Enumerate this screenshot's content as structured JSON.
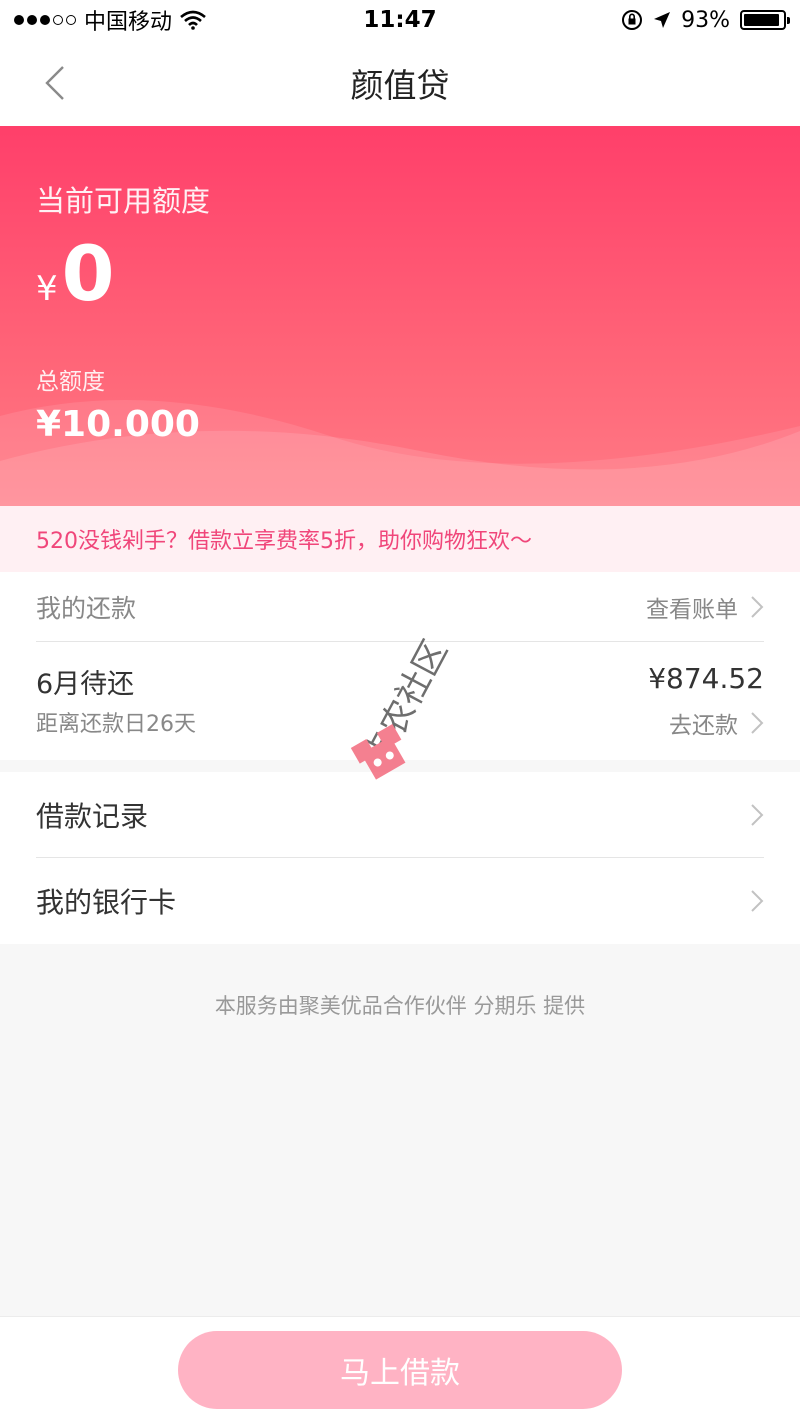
{
  "status_bar": {
    "carrier": "中国移动",
    "time": "11:47",
    "battery": "93%",
    "battery_level": 0.93,
    "signal_bars": 3
  },
  "nav": {
    "title": "颜值贷",
    "back_icon": "chevron-left-icon"
  },
  "hero": {
    "available_label": "当前可用额度",
    "currency_symbol": "¥",
    "available_value": "0",
    "total_label": "总额度",
    "total_value": "¥10.000"
  },
  "promo": {
    "text": "520没钱剁手？借款立享费率5折，助你购物狂欢～"
  },
  "repayment": {
    "section_label": "我的还款",
    "view_bill_label": "查看账单",
    "due_title": "6月待还",
    "due_subtitle": "距离还款日26天",
    "due_amount": "¥874.52",
    "repay_label": "去还款"
  },
  "menu": {
    "items": [
      {
        "label": "借款记录"
      },
      {
        "label": "我的银行卡"
      }
    ]
  },
  "footnote": "本服务由聚美优品合作伙伴 分期乐 提供",
  "bottom": {
    "borrow_label": "马上借款"
  },
  "watermark": {
    "text": "卡农社区"
  },
  "colors": {
    "brand": "#ff3f6a",
    "promo_text": "#f0467a",
    "button_disabled": "#ffb3c4"
  }
}
